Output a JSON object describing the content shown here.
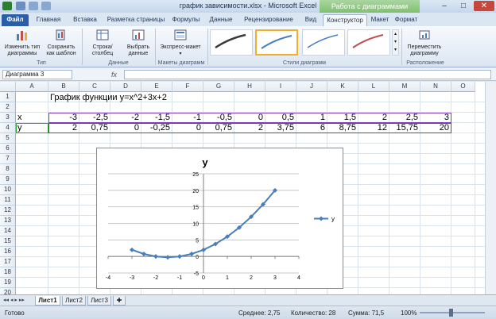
{
  "window": {
    "title": "график зависимости.xlsx  -  Microsoft Excel",
    "context_tab_group": "Работа с диаграммами"
  },
  "tabs": [
    "Файл",
    "Главная",
    "Вставка",
    "Разметка страницы",
    "Формулы",
    "Данные",
    "Рецензирование",
    "Вид",
    "Конструктор",
    "Макет",
    "Формат"
  ],
  "ribbon": {
    "change_type": "Изменить тип диаграммы",
    "save_template": "Сохранить как шаблон",
    "group_type": "Тип",
    "row_col": "Строка/столбец",
    "select_data": "Выбрать данные",
    "group_data": "Данные",
    "express_layout": "Экспресс-макет",
    "group_layouts": "Макеты диаграмм",
    "group_styles": "Стили диаграмм",
    "move_chart": "Переместить диаграмму",
    "group_location": "Расположение"
  },
  "formula_bar": {
    "name_box": "Диаграмма 3",
    "fx": "fx"
  },
  "columns": [
    "A",
    "B",
    "C",
    "D",
    "E",
    "F",
    "G",
    "H",
    "I",
    "J",
    "K",
    "L",
    "M",
    "N",
    "O"
  ],
  "rows": [
    "1",
    "2",
    "3",
    "4",
    "5",
    "6",
    "7",
    "8",
    "9",
    "10",
    "11",
    "12",
    "13",
    "14",
    "15",
    "16",
    "17",
    "18",
    "19",
    "20"
  ],
  "sheet": {
    "title": "График функции y=x^2+3x+2",
    "x_label": "x",
    "y_label": "y",
    "x_values": [
      "-3",
      "-2,5",
      "-2",
      "-1,5",
      "-1",
      "-0,5",
      "0",
      "0,5",
      "1",
      "1,5",
      "2",
      "2,5",
      "3"
    ],
    "y_values": [
      "2",
      "0,75",
      "0",
      "-0,25",
      "0",
      "0,75",
      "2",
      "3,75",
      "6",
      "8,75",
      "12",
      "15,75",
      "20"
    ]
  },
  "chart_data": {
    "type": "scatter",
    "title": "y",
    "series": [
      {
        "name": "y",
        "x": [
          -3,
          -2.5,
          -2,
          -1.5,
          -1,
          -0.5,
          0,
          0.5,
          1,
          1.5,
          2,
          2.5,
          3
        ],
        "y": [
          2,
          0.75,
          0,
          -0.25,
          0,
          0.75,
          2,
          3.75,
          6,
          8.75,
          12,
          15.75,
          20
        ]
      }
    ],
    "xlim": [
      -4,
      4
    ],
    "ylim": [
      -5,
      25
    ],
    "x_ticks": [
      -4,
      -3,
      -2,
      -1,
      0,
      1,
      2,
      3,
      4
    ],
    "y_ticks": [
      -5,
      0,
      5,
      10,
      15,
      20,
      25
    ],
    "grid": "horizontal",
    "legend": "right",
    "series_color": "#4a7ebb"
  },
  "sheet_tabs": [
    "Лист1",
    "Лист2",
    "Лист3"
  ],
  "status": {
    "ready": "Готово",
    "average": "Среднее: 2,75",
    "count": "Количество: 28",
    "sum": "Сумма: 71,5",
    "zoom": "100%"
  }
}
